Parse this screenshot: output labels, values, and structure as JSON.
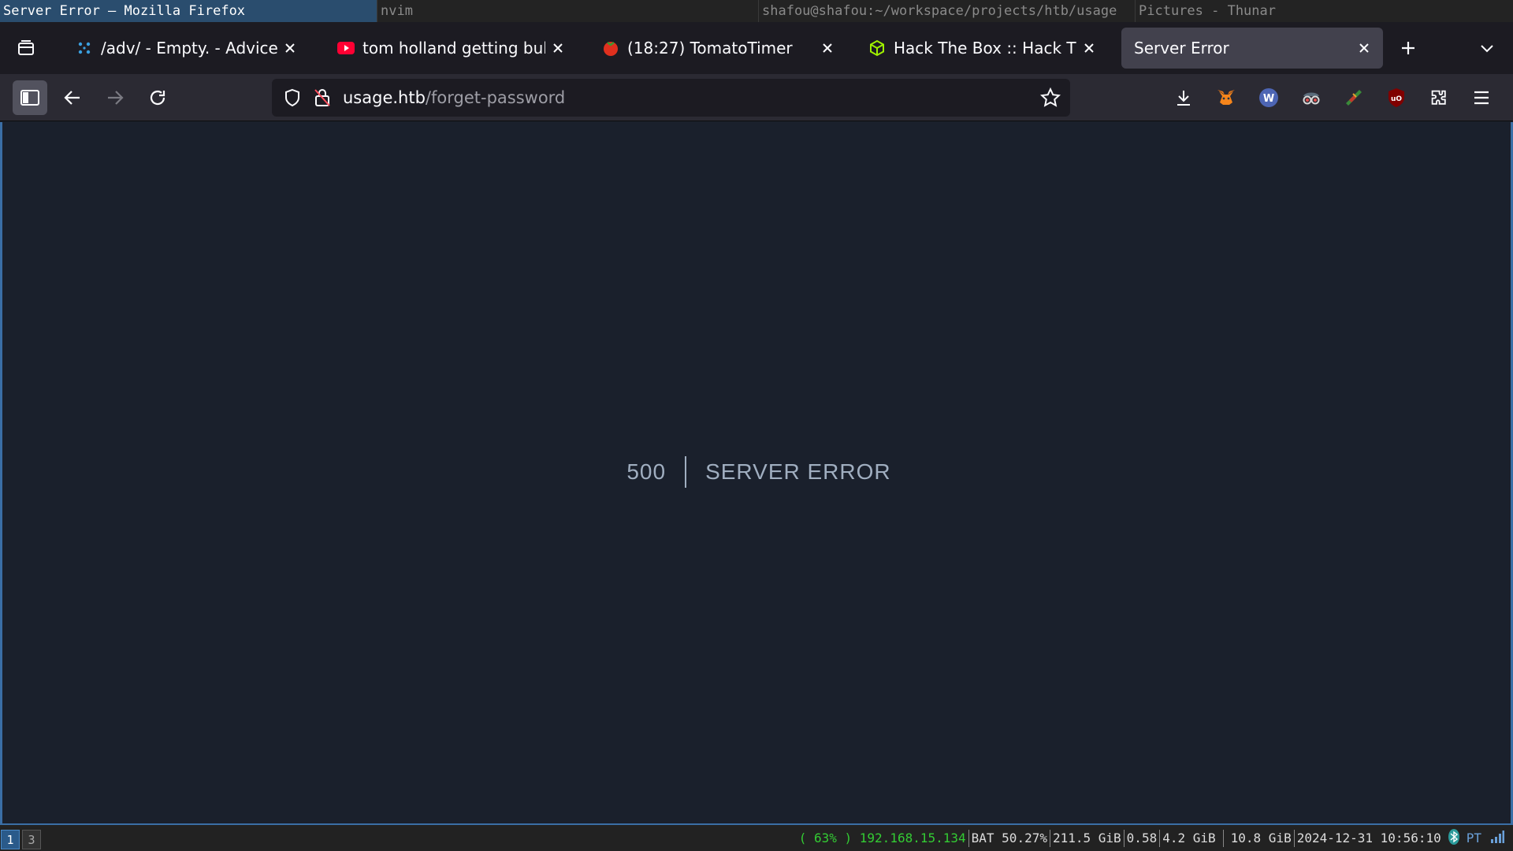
{
  "wm": {
    "windows": [
      {
        "title": "Server Error — Mozilla Firefox",
        "active": true
      },
      {
        "title": "nvim"
      },
      {
        "title": "shafou@shafou:~/workspace/projects/htb/usage"
      },
      {
        "title": "Pictures - Thunar"
      }
    ]
  },
  "browser": {
    "tabs": [
      {
        "label": "/adv/ - Empty. - Advice - ",
        "favicon": "advice-favicon"
      },
      {
        "label": "tom holland getting bulli",
        "favicon": "youtube-favicon"
      },
      {
        "label": "(18:27) TomatoTimer",
        "favicon": "tomato-favicon"
      },
      {
        "label": "Hack The Box :: Hack Th",
        "favicon": "htb-favicon"
      },
      {
        "label": "Server Error",
        "favicon": "none",
        "active": true
      }
    ],
    "url": {
      "host": "usage.htb",
      "path": "/forget-password"
    },
    "toolbar_icons": [
      "download-icon",
      "metamask-icon",
      "wappalyzer-icon",
      "spy-extension-icon",
      "extension-icon",
      "ublock-icon",
      "extensions-icon",
      "menu-icon"
    ]
  },
  "page": {
    "error_code": "500",
    "error_message": "Server Error"
  },
  "statusbar": {
    "workspaces": [
      "1",
      "3"
    ],
    "wifi": "( 63% ) 192.168.15.134",
    "battery": "BAT 50.27%",
    "disk": "211.5 GiB",
    "load": "0.58",
    "memory": "4.2 GiB",
    "memory_total": "10.8 GiB",
    "datetime": "2024-12-31 10:56:10",
    "keyboard": "PT"
  },
  "colors": {
    "accent": "#3a6ea5",
    "page_bg": "#1a202c",
    "error_text": "#a0aec0",
    "wifi_green": "#33cc33"
  }
}
